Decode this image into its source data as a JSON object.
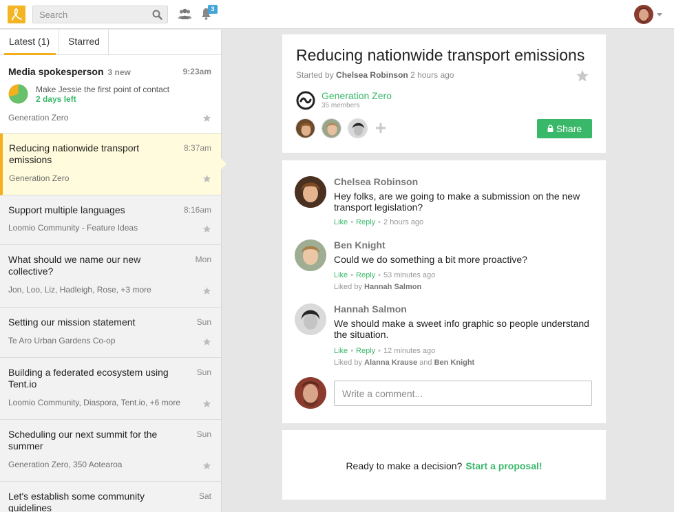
{
  "topbar": {
    "search_placeholder": "Search",
    "notification_count": "3"
  },
  "sidebar": {
    "tabs": [
      {
        "label": "Latest (1)"
      },
      {
        "label": "Starred"
      }
    ],
    "highlight": {
      "title": "Media spokesperson",
      "new_count": "3 new",
      "time": "9:23am",
      "proposal_text": "Make Jessie the first point of contact",
      "time_left": "2 days left",
      "group": "Generation Zero",
      "pie_progress": 0.7
    },
    "items": [
      {
        "title": "Reducing nationwide transport emissions",
        "time": "8:37am",
        "group": "Generation Zero"
      },
      {
        "title": "Support multiple languages",
        "time": "8:16am",
        "group": "Loomio Community - Feature Ideas"
      },
      {
        "title": "What should we name our new collective?",
        "time": "Mon",
        "group": "Jon, Loo, Liz, Hadleigh, Rose, +3 more"
      },
      {
        "title": "Setting our mission statement",
        "time": "Sun",
        "group": "Te Aro Urban Gardens Co-op"
      },
      {
        "title": "Building a federated ecosystem using Tent.io",
        "time": "Sun",
        "group": "Loomio Community, Diaspora, Tent.io, +6 more"
      },
      {
        "title": "Scheduling our next summit for the summer",
        "time": "Sun",
        "group": "Generation Zero, 350 Aotearoa"
      },
      {
        "title": "Let's establish some community guidelines",
        "time": "Sat",
        "group": ""
      }
    ]
  },
  "discussion": {
    "title": "Reducing nationwide transport emissions",
    "started_prefix": "Started by",
    "started_by": "Chelsea Robinson",
    "started_when": "2 hours ago",
    "group_name": "Generation Zero",
    "group_members": "35 members",
    "share_label": "Share"
  },
  "comments": [
    {
      "author": "Chelsea Robinson",
      "body": "Hey folks, are we going to make a submission on the new transport legislation?",
      "like": "Like",
      "reply": "Reply",
      "when": "2 hours ago"
    },
    {
      "author": "Ben Knight",
      "body": "Could we do something a bit more proactive?",
      "like": "Like",
      "reply": "Reply",
      "when": "53 minutes ago",
      "liked_prefix": "Liked by",
      "liked_by": "Hannah Salmon"
    },
    {
      "author": "Hannah Salmon",
      "body": "We should make a sweet info graphic so people understand the situation.",
      "like": "Like",
      "reply": "Reply",
      "when": "12 minutes ago",
      "liked_prefix": "Liked by",
      "liked_by_1": "Alanna Krause",
      "liked_and": "and",
      "liked_by_2": "Ben Knight"
    }
  ],
  "comment_box": {
    "placeholder": "Write a comment..."
  },
  "proposal": {
    "prompt": "Ready to make a decision?",
    "link": "Start a proposal!"
  },
  "colors": {
    "brand_yellow": "#f2b01e",
    "action_green": "#3ab86a",
    "badge_blue": "#46a5d8"
  }
}
